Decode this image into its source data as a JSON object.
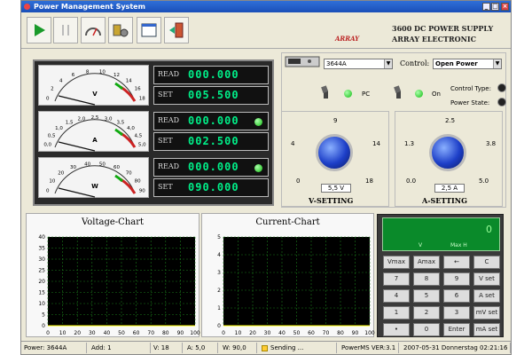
{
  "window": {
    "title": "Power Management System"
  },
  "brand": {
    "line1": "3600 DC POWER SUPPLY",
    "line2": "ARRAY ELECTRONIC",
    "logo": "ARRAY"
  },
  "toolbar": {
    "items": [
      {
        "name": "play",
        "icon": "play-icon"
      },
      {
        "name": "pause",
        "icon": "pause-icon"
      },
      {
        "name": "meter",
        "icon": "meter-icon"
      },
      {
        "name": "settings",
        "icon": "tools-icon"
      },
      {
        "name": "window",
        "icon": "window-icon"
      },
      {
        "name": "exit",
        "icon": "exit-door-icon"
      }
    ]
  },
  "meters": [
    {
      "unit": "V",
      "scale": [
        "0",
        "2",
        "4",
        "6",
        "8",
        "10",
        "12",
        "14",
        "16",
        "18"
      ],
      "read": "000.000",
      "set": "005.500",
      "led": false
    },
    {
      "unit": "A",
      "scale": [
        "0,0",
        "0,5",
        "1,0",
        "1,5",
        "2,0",
        "2,5",
        "3,0",
        "3,5",
        "4,0",
        "4,5",
        "5,0"
      ],
      "read": "000.000",
      "set": "002.500",
      "led": true
    },
    {
      "unit": "W",
      "scale": [
        "0",
        "10",
        "20",
        "30",
        "40",
        "50",
        "60",
        "70",
        "80",
        "90"
      ],
      "read": "000.000",
      "set": "090.000",
      "led": true
    }
  ],
  "labels": {
    "read": "READ",
    "set": "SET"
  },
  "control": {
    "model": "3644A",
    "control_label": "Control:",
    "control_value": "Open Power",
    "pc_label": "PC",
    "on_label": "On",
    "control_type_label": "Control Type:",
    "power_state_label": "Power State:"
  },
  "vknob": {
    "ticks": [
      "9",
      "4",
      "14",
      "0",
      "18"
    ],
    "value": "5,5 V",
    "label": "V-SETTING"
  },
  "aknob": {
    "ticks": [
      "2.5",
      "1.3",
      "3.8",
      "0.0",
      "5.0"
    ],
    "value": "2,5 A",
    "label": "A-SETTING"
  },
  "chart_data": [
    {
      "type": "line",
      "title": "Voltage-Chart",
      "x": [
        0,
        10,
        20,
        30,
        40,
        50,
        60,
        70,
        80,
        90,
        100
      ],
      "ylim": [
        0,
        40
      ],
      "yticks": [
        0,
        5,
        10,
        15,
        20,
        25,
        30,
        35,
        40
      ],
      "series": [
        {
          "values": [
            0,
            0,
            0,
            0,
            0,
            0,
            0,
            0,
            0,
            0,
            0
          ]
        }
      ]
    },
    {
      "type": "line",
      "title": "Current-Chart",
      "x": [
        0,
        10,
        20,
        30,
        40,
        50,
        60,
        70,
        80,
        90,
        100
      ],
      "ylim": [
        0,
        5
      ],
      "yticks": [
        0,
        1,
        2,
        3,
        4,
        5
      ],
      "series": [
        {
          "values": [
            0,
            0,
            0,
            0,
            0,
            0,
            0,
            0,
            0,
            0,
            0
          ]
        }
      ]
    }
  ],
  "keypad": {
    "display_value": "0",
    "display_unit_left": "V",
    "display_unit_right": "Max H",
    "keys": [
      "Vmax",
      "Amax",
      "←",
      "C",
      "7",
      "8",
      "9",
      "V set",
      "4",
      "5",
      "6",
      "A set",
      "1",
      "2",
      "3",
      "mV set",
      "•",
      "0",
      "Enter",
      "mA set"
    ]
  },
  "status": [
    "Power: 3644A",
    "Add:  1",
    "V:  18",
    "A:  5,0",
    "W:  90,0",
    "Sending ...",
    "PowerMS VER:3.1",
    "2007-05-31 Donnerstag 02:21:16"
  ]
}
